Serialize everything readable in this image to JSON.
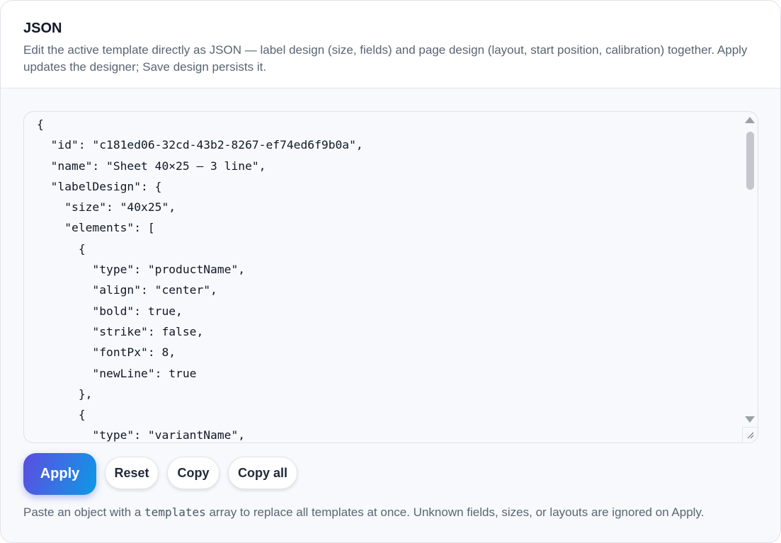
{
  "panel": {
    "title": "JSON",
    "description": "Edit the active template directly as JSON — label design (size, fields) and page design (layout, start position, calibration) together. Apply updates the designer; Save design persists it."
  },
  "editor": {
    "content": "{\n  \"id\": \"c181ed06-32cd-43b2-8267-ef74ed6f9b0a\",\n  \"name\": \"Sheet 40×25 — 3 line\",\n  \"labelDesign\": {\n    \"size\": \"40x25\",\n    \"elements\": [\n      {\n        \"type\": \"productName\",\n        \"align\": \"center\",\n        \"bold\": true,\n        \"strike\": false,\n        \"fontPx\": 8,\n        \"newLine\": true\n      },\n      {\n        \"type\": \"variantName\","
  },
  "actions": {
    "apply": "Apply",
    "reset": "Reset",
    "copy": "Copy",
    "copy_all": "Copy all"
  },
  "footnote": {
    "before": "Paste an object with a ",
    "code": "templates",
    "after": " array to replace all templates at once. Unknown fields, sizes, or layouts are ignored on Apply."
  },
  "colors": {
    "apply_gradient_start": "#5a4de0",
    "apply_gradient_end": "#0b9ae6",
    "text_muted": "#5b6472"
  },
  "icons": [
    "scroll-up-arrow-icon",
    "scroll-down-arrow-icon",
    "resize-grip-icon"
  ]
}
